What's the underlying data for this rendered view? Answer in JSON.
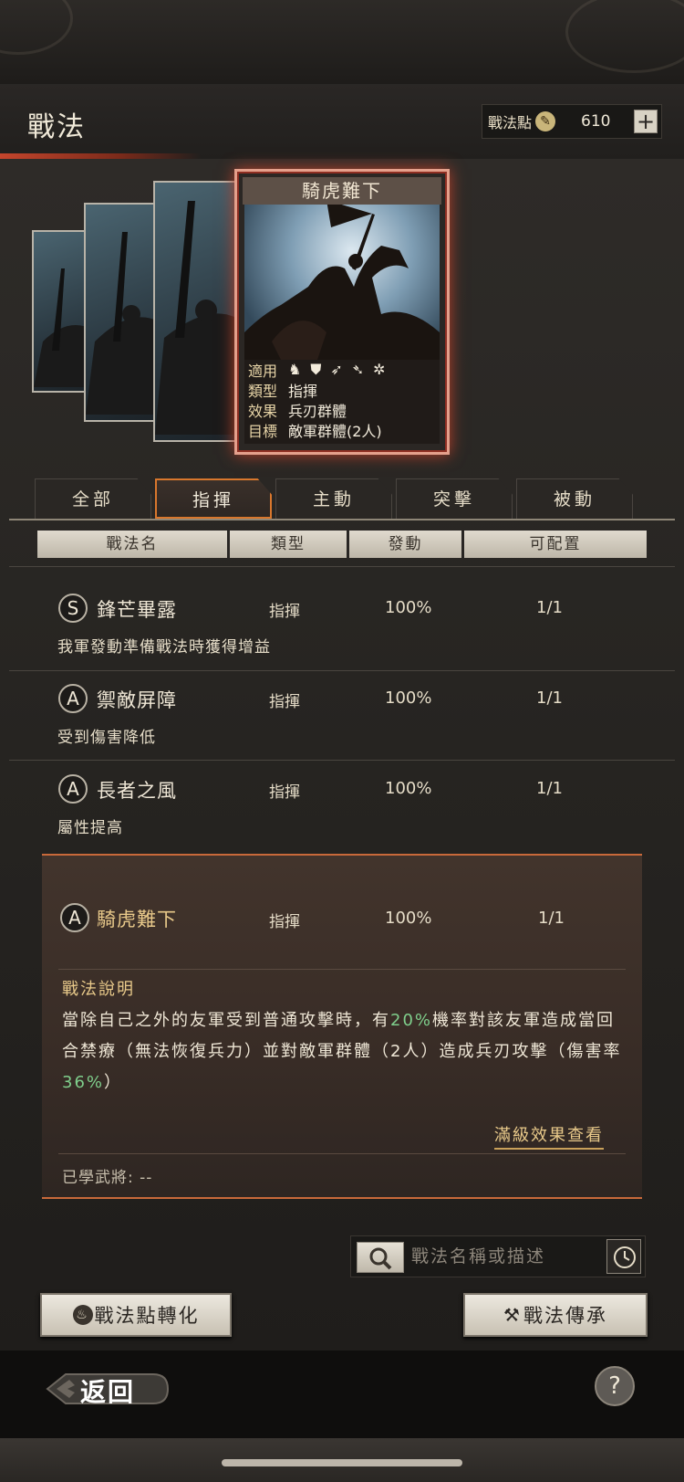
{
  "header": {
    "title": "戰法",
    "points_label": "戰法點",
    "points_value": "610",
    "add_label": "+"
  },
  "featured_card": {
    "name": "騎虎難下",
    "info": [
      {
        "key": "適用",
        "value": ""
      },
      {
        "key": "類型",
        "value": "指揮"
      },
      {
        "key": "效果",
        "value": "兵刃群體"
      },
      {
        "key": "目標",
        "value": "敵軍群體(2人)"
      }
    ],
    "unit_icons": [
      "cavalry-icon",
      "shield-icon",
      "bow-icon",
      "spear-icon",
      "wheel-icon"
    ]
  },
  "tabs": [
    {
      "label": "全部",
      "active": false
    },
    {
      "label": "指揮",
      "active": true
    },
    {
      "label": "主動",
      "active": false
    },
    {
      "label": "突擊",
      "active": false
    },
    {
      "label": "被動",
      "active": false
    }
  ],
  "columns": [
    "戰法名",
    "類型",
    "發動",
    "可配置"
  ],
  "tactics": [
    {
      "grade": "S",
      "name": "鋒芒畢露",
      "type": "指揮",
      "rate": "100%",
      "slots": "1/1",
      "desc": "我軍發動準備戰法時獲得增益"
    },
    {
      "grade": "A",
      "name": "禦敵屏障",
      "type": "指揮",
      "rate": "100%",
      "slots": "1/1",
      "desc": "受到傷害降低"
    },
    {
      "grade": "A",
      "name": "長者之風",
      "type": "指揮",
      "rate": "100%",
      "slots": "1/1",
      "desc": "屬性提高"
    }
  ],
  "selected": {
    "grade": "A",
    "name": "騎虎難下",
    "type": "指揮",
    "rate": "100%",
    "slots": "1/1",
    "desc_title": "戰法說明",
    "desc_part1": "當除自己之外的友軍受到普通攻擊時，有",
    "desc_pct1": "20%",
    "desc_part2": "機率對該友軍造成當回合禁療（無法恢復兵力）並對敵軍群體（2人）造成兵刃攻擊（傷害率",
    "desc_pct2": "36%",
    "desc_part3": "）",
    "full_link": "滿級效果查看",
    "learned": "已學武將: --"
  },
  "search": {
    "placeholder": "戰法名稱或描述"
  },
  "buttons": {
    "convert": "戰法點轉化",
    "inherit": "戰法傳承"
  },
  "footer": {
    "back": "返回",
    "help": "?"
  }
}
